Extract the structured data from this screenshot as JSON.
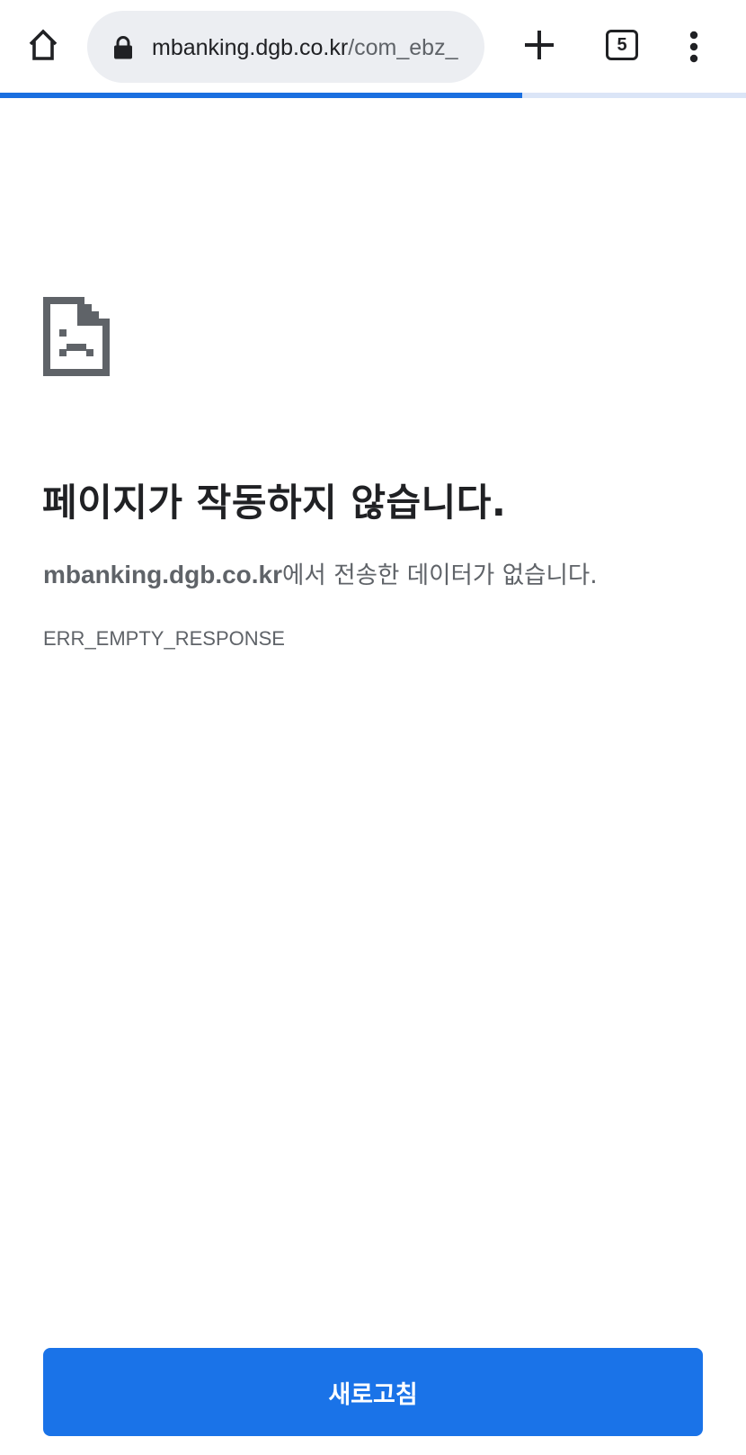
{
  "browser": {
    "omnibox": {
      "host": "mbanking.dgb.co.kr",
      "path": "/com_ebz_"
    },
    "tab_count": "5",
    "load_progress": 0.7,
    "icons": {
      "home": "home-icon",
      "lock": "lock-icon",
      "new_tab": "plus-icon",
      "tab_switcher": "tab-switcher-icon",
      "menu": "more-vert-icon"
    },
    "colors": {
      "progress": "#1a6fe0",
      "omnibox_bg": "#eceef2"
    }
  },
  "error_page": {
    "icon": "sad-document-icon",
    "title": "페이지가 작동하지 않습니다.",
    "host": "mbanking.dgb.co.kr",
    "message_suffix": "에서 전송한 데이터가 없습니다.",
    "error_code": "ERR_EMPTY_RESPONSE",
    "reload_label": "새로고침",
    "colors": {
      "button": "#1a73e8",
      "title": "#202124",
      "secondary": "#5f6368"
    }
  }
}
